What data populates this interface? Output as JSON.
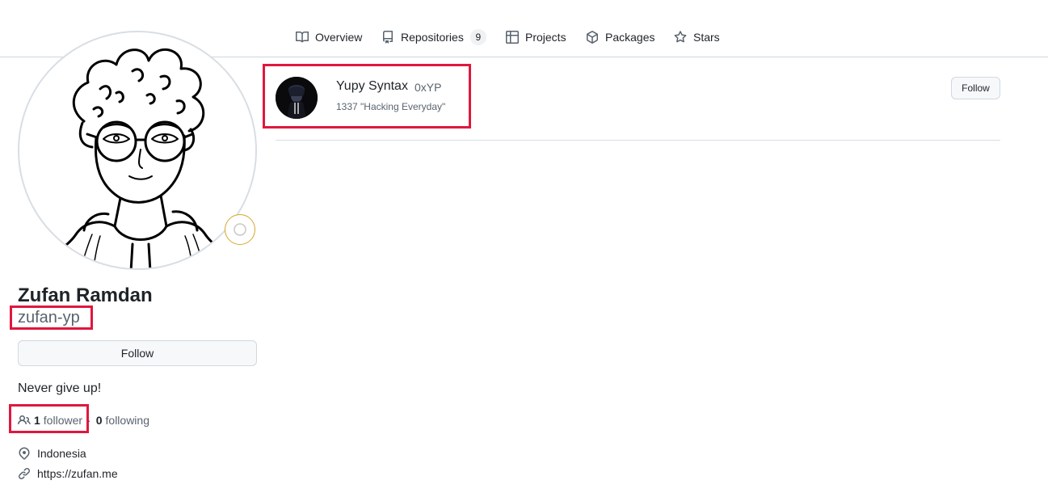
{
  "nav": {
    "tabs": [
      {
        "label": "Overview",
        "icon": "book-icon"
      },
      {
        "label": "Repositories",
        "icon": "repo-icon",
        "count": "9"
      },
      {
        "label": "Projects",
        "icon": "table-icon"
      },
      {
        "label": "Packages",
        "icon": "package-icon"
      },
      {
        "label": "Stars",
        "icon": "star-icon"
      }
    ]
  },
  "profile": {
    "full_name": "Zufan Ramdan",
    "username": "zufan-yp",
    "follow_label": "Follow",
    "bio": "Never give up!",
    "followers_count": "1",
    "followers_label": "follower",
    "following_count": "0",
    "following_label": "following",
    "location": "Indonesia",
    "website": "https://zufan.me"
  },
  "follower_card": {
    "name": "Yupy Syntax",
    "login": "0xYP",
    "bio": "1337 \"Hacking Everyday\"",
    "follow_label": "Follow"
  },
  "colors": {
    "highlight": "#e0173e",
    "muted_text": "#59636e",
    "border": "#d0d7de"
  }
}
